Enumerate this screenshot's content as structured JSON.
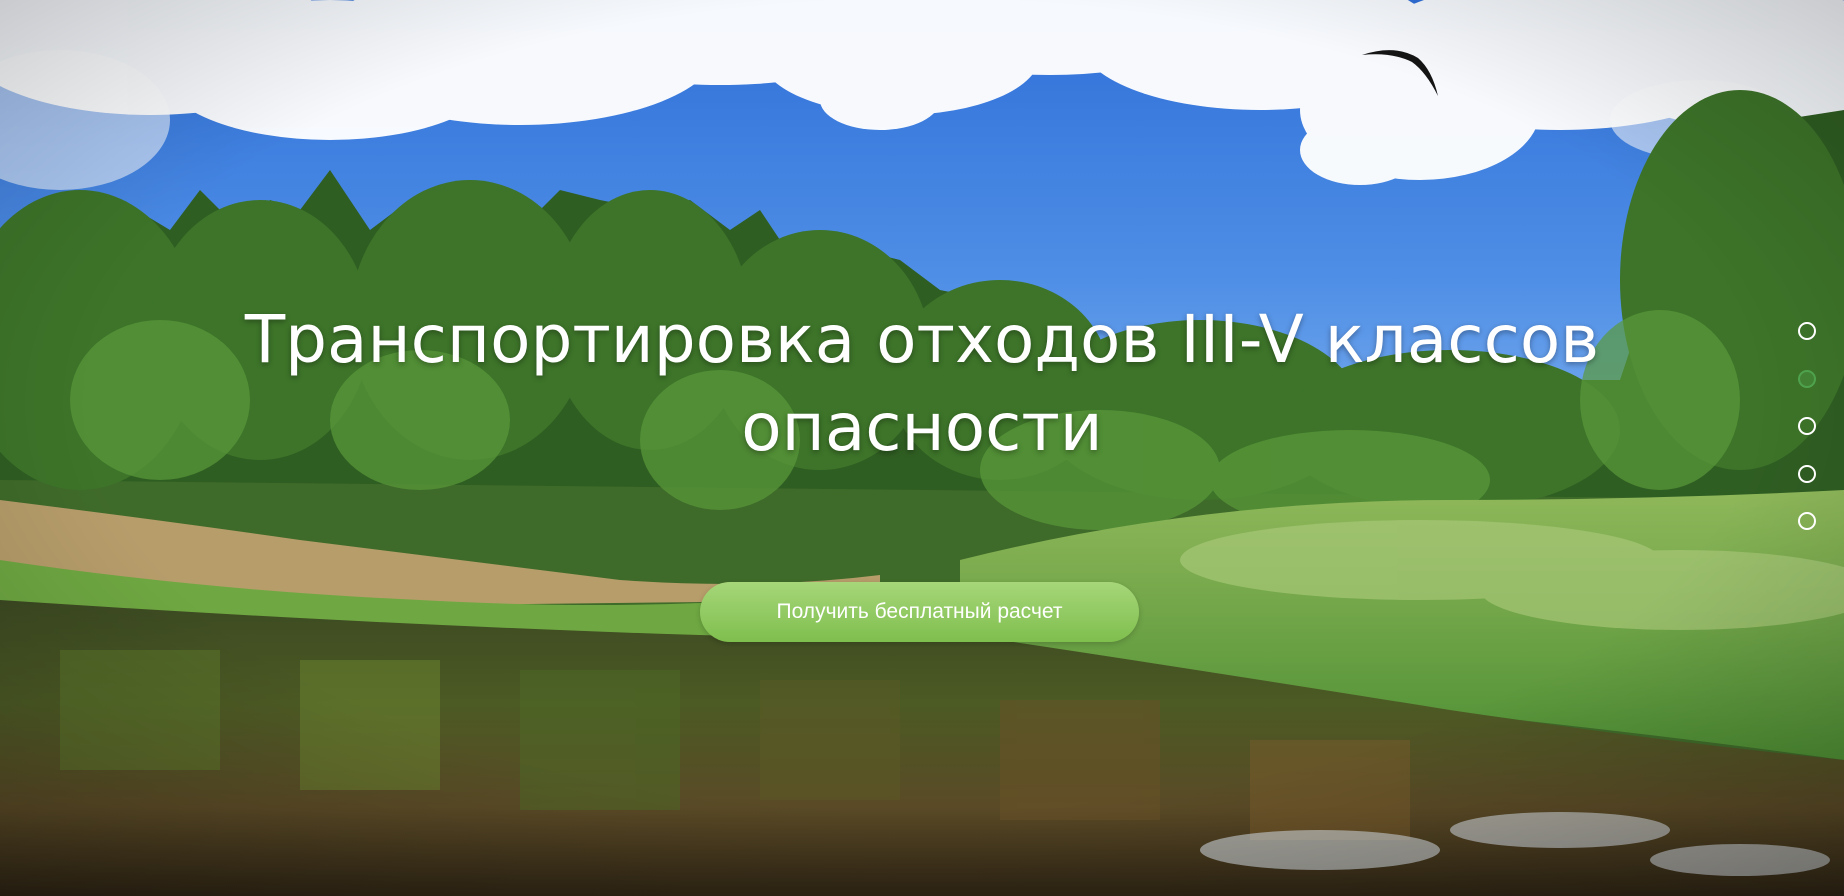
{
  "hero": {
    "title": "Транспортировка отходов III-V классов опасности",
    "cta_label": "Получить бесплатный расчет"
  },
  "slider": {
    "slide_count": 5,
    "active_index": 1
  },
  "colors": {
    "cta_gradient_top": "#a6d679",
    "cta_gradient_bottom": "#7fbf4e",
    "active_dot": "#4fa24d",
    "title_text": "#ffffff"
  }
}
